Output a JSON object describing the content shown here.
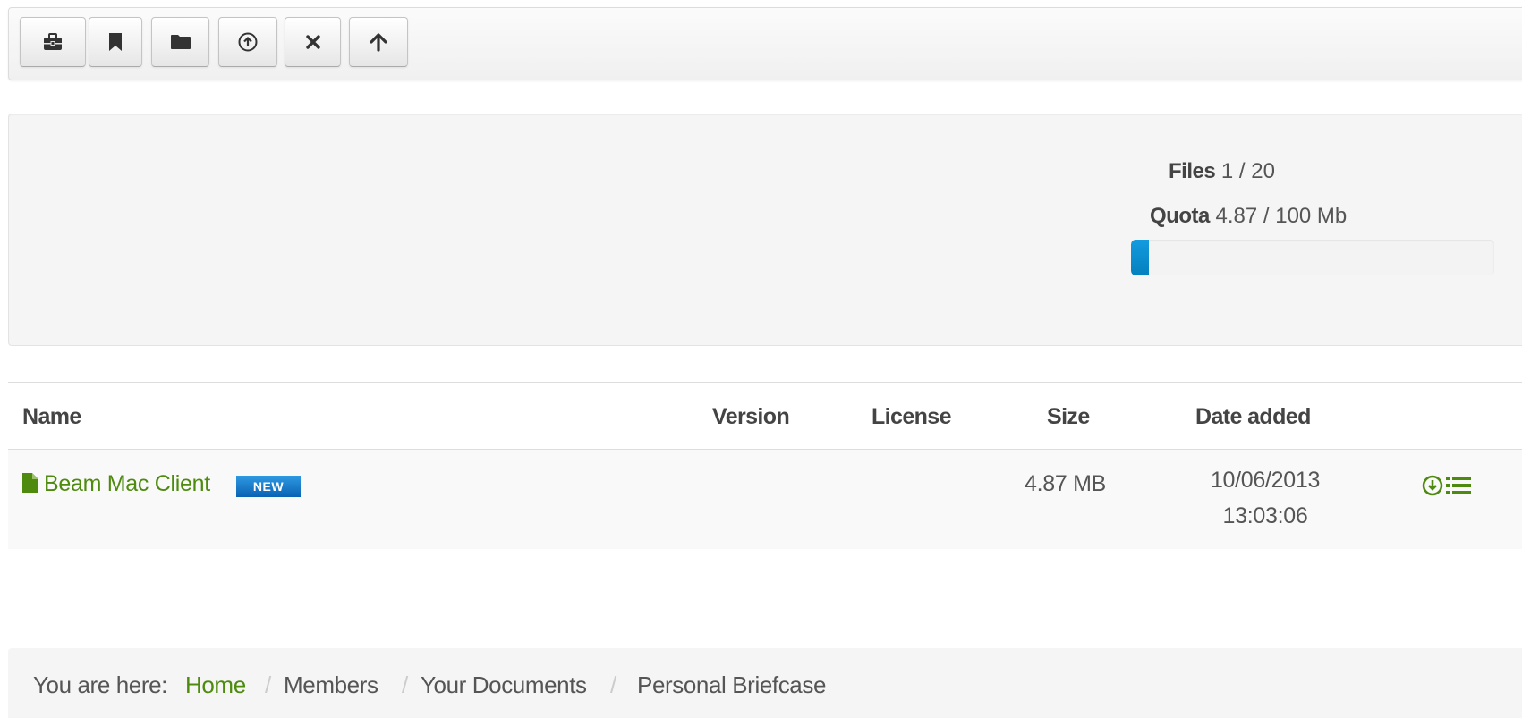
{
  "toolbar": {
    "buttons": [
      {
        "icon": "briefcase-icon"
      },
      {
        "icon": "bookmark-icon"
      },
      {
        "icon": "folder-icon"
      },
      {
        "icon": "upload-circle-icon"
      },
      {
        "icon": "close-icon"
      },
      {
        "icon": "arrow-up-icon"
      }
    ]
  },
  "stats": {
    "files_label": "Files",
    "files_value": "1 / 20",
    "quota_label": "Quota",
    "quota_value": "4.87 / 100 Mb",
    "quota_fraction": 0.0487
  },
  "table": {
    "headers": {
      "name": "Name",
      "version": "Version",
      "license": "License",
      "size": "Size",
      "date_added": "Date added"
    },
    "rows": [
      {
        "name": "Beam Mac Client",
        "badge": "NEW",
        "version": "",
        "license": "",
        "size": "4.87 MB",
        "date": "10/06/2013",
        "time": "13:03:06",
        "actions": [
          "download-circle-icon",
          "details-list-icon"
        ]
      }
    ]
  },
  "breadcrumb": {
    "prefix": "You are here:",
    "items": [
      "Home",
      "Members",
      "Your Documents",
      "Personal Briefcase"
    ],
    "separator": "/"
  },
  "colors": {
    "link": "#4e8a0e",
    "progress": "#0e90d2",
    "badge": "#1a7bd0"
  }
}
